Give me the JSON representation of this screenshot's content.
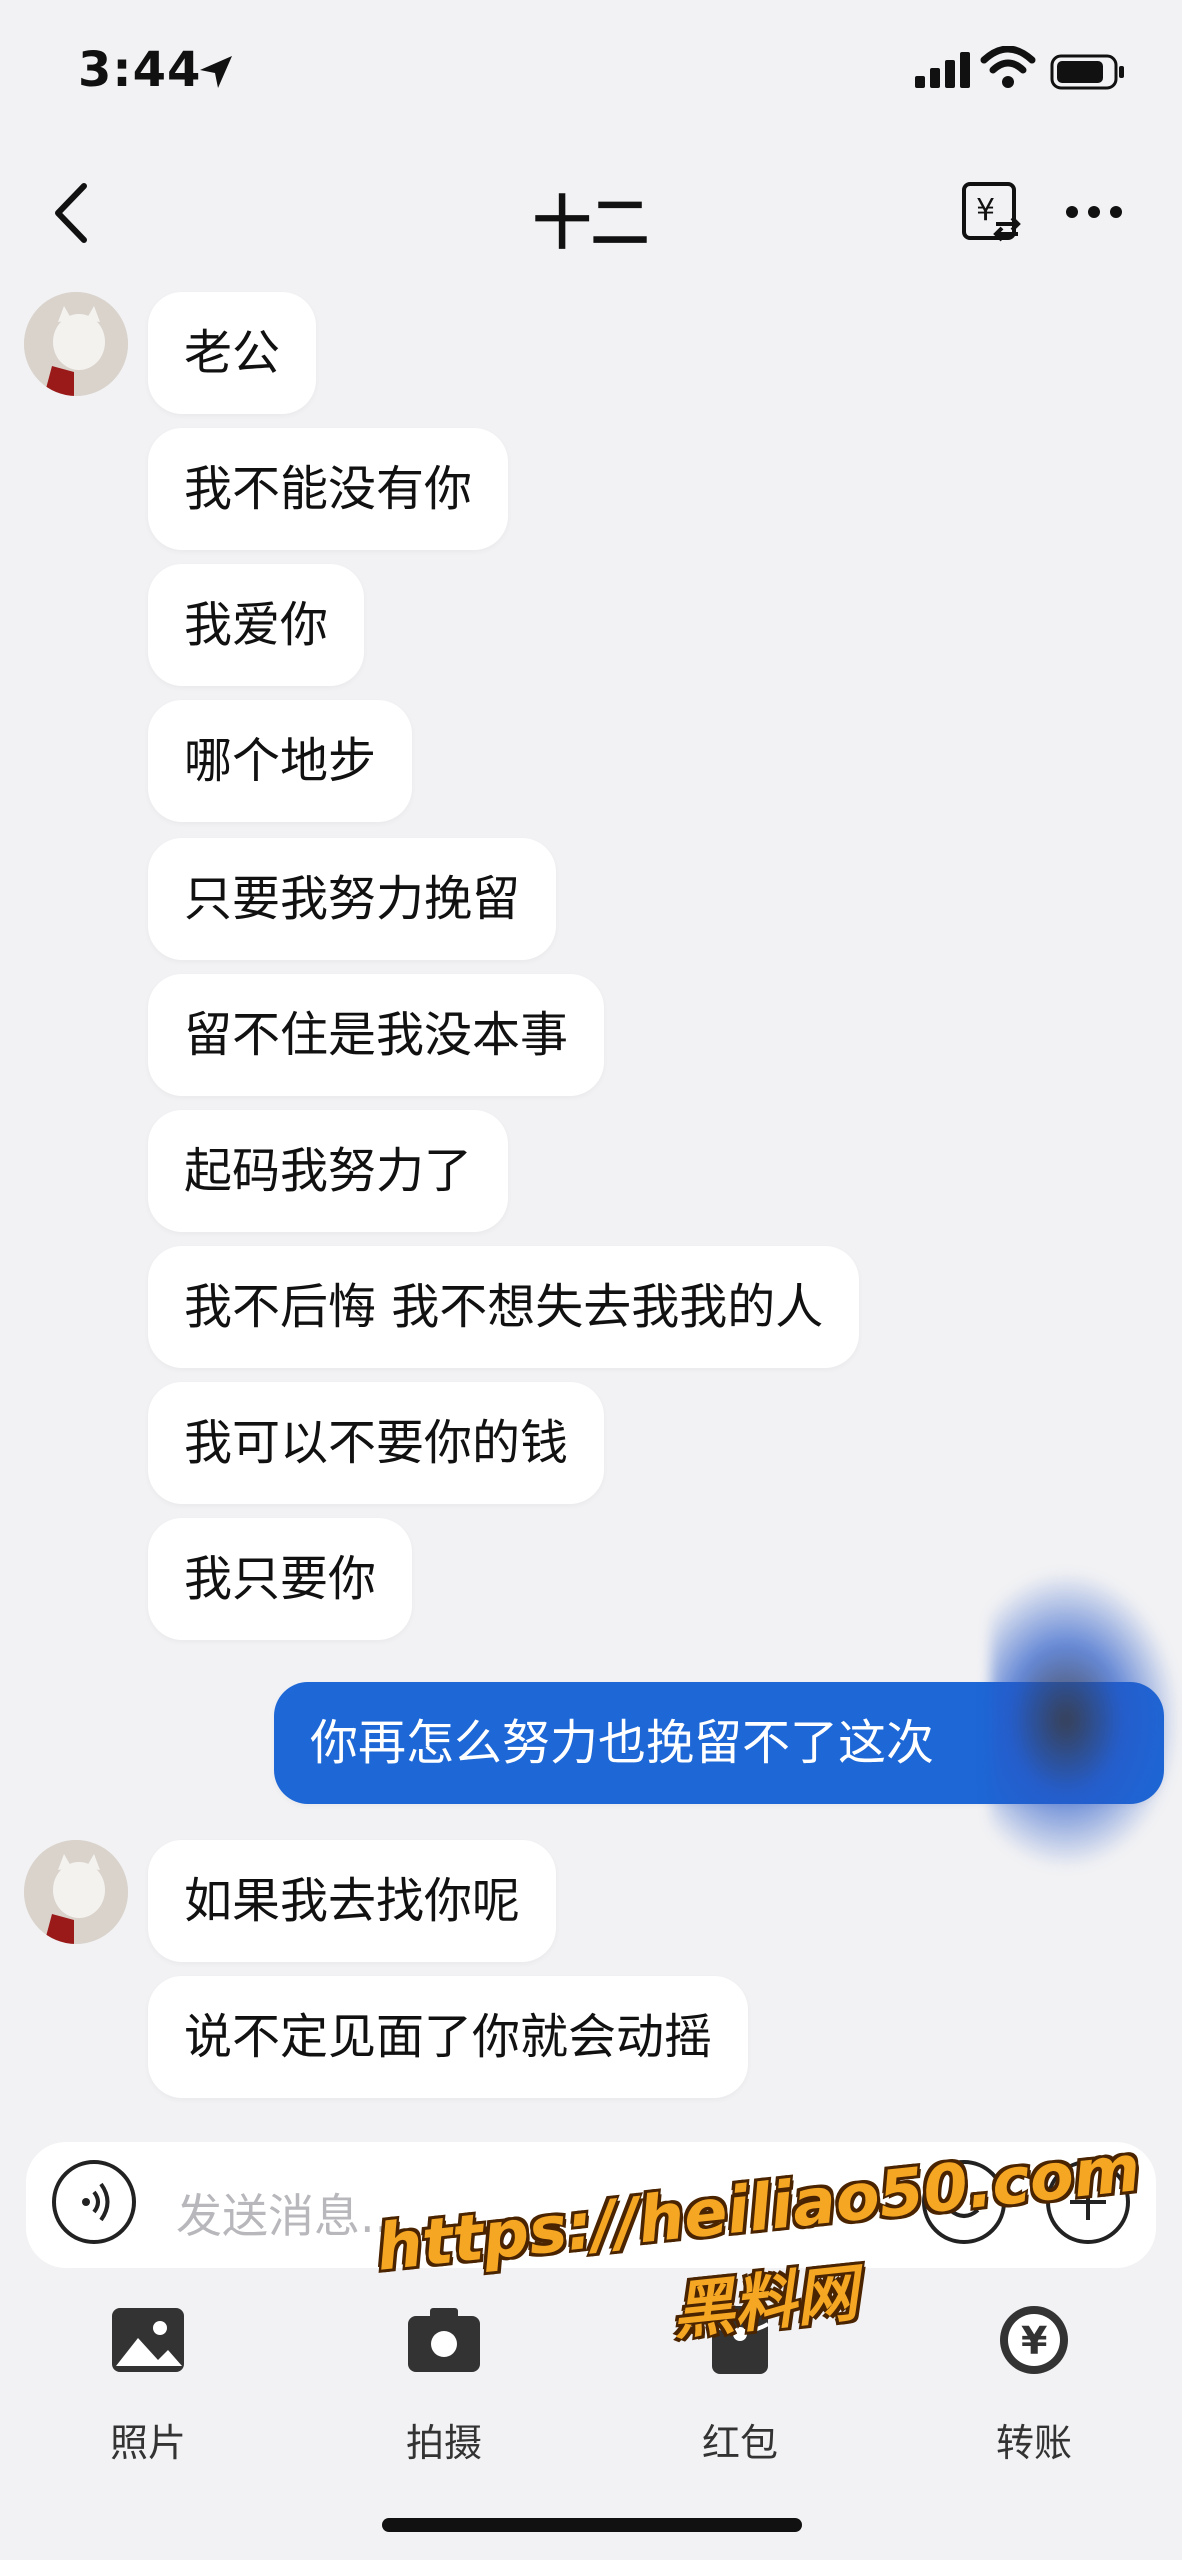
{
  "status_bar": {
    "time": "3:44"
  },
  "header": {
    "title": "十二"
  },
  "messages": [
    {
      "from": "other",
      "text": "老公"
    },
    {
      "from": "other",
      "text": "我不能没有你"
    },
    {
      "from": "other",
      "text": "我爱你"
    },
    {
      "from": "other",
      "text": "哪个地步"
    },
    {
      "from": "other",
      "text": "只要我努力挽留"
    },
    {
      "from": "other",
      "text": "留不住是我没本事"
    },
    {
      "from": "other",
      "text": "起码我努力了"
    },
    {
      "from": "other",
      "text": "我不后悔 我不想失去我我的人"
    },
    {
      "from": "other",
      "text": "我可以不要你的钱"
    },
    {
      "from": "other",
      "text": "我只要你"
    },
    {
      "from": "me",
      "text": "你再怎么努力也挽留不了这次"
    },
    {
      "from": "other",
      "text": "如果我去找你呢"
    },
    {
      "from": "other",
      "text": "说不定见面了你就会动摇"
    }
  ],
  "input": {
    "placeholder": "发送消息..."
  },
  "tools": [
    {
      "label": "照片",
      "icon": "photo-icon"
    },
    {
      "label": "拍摄",
      "icon": "camera-icon"
    },
    {
      "label": "红包",
      "icon": "red-packet-icon"
    },
    {
      "label": "转账",
      "icon": "transfer-icon"
    }
  ],
  "watermark": {
    "url": "https://heiliao50.com",
    "name": "黑料网"
  }
}
